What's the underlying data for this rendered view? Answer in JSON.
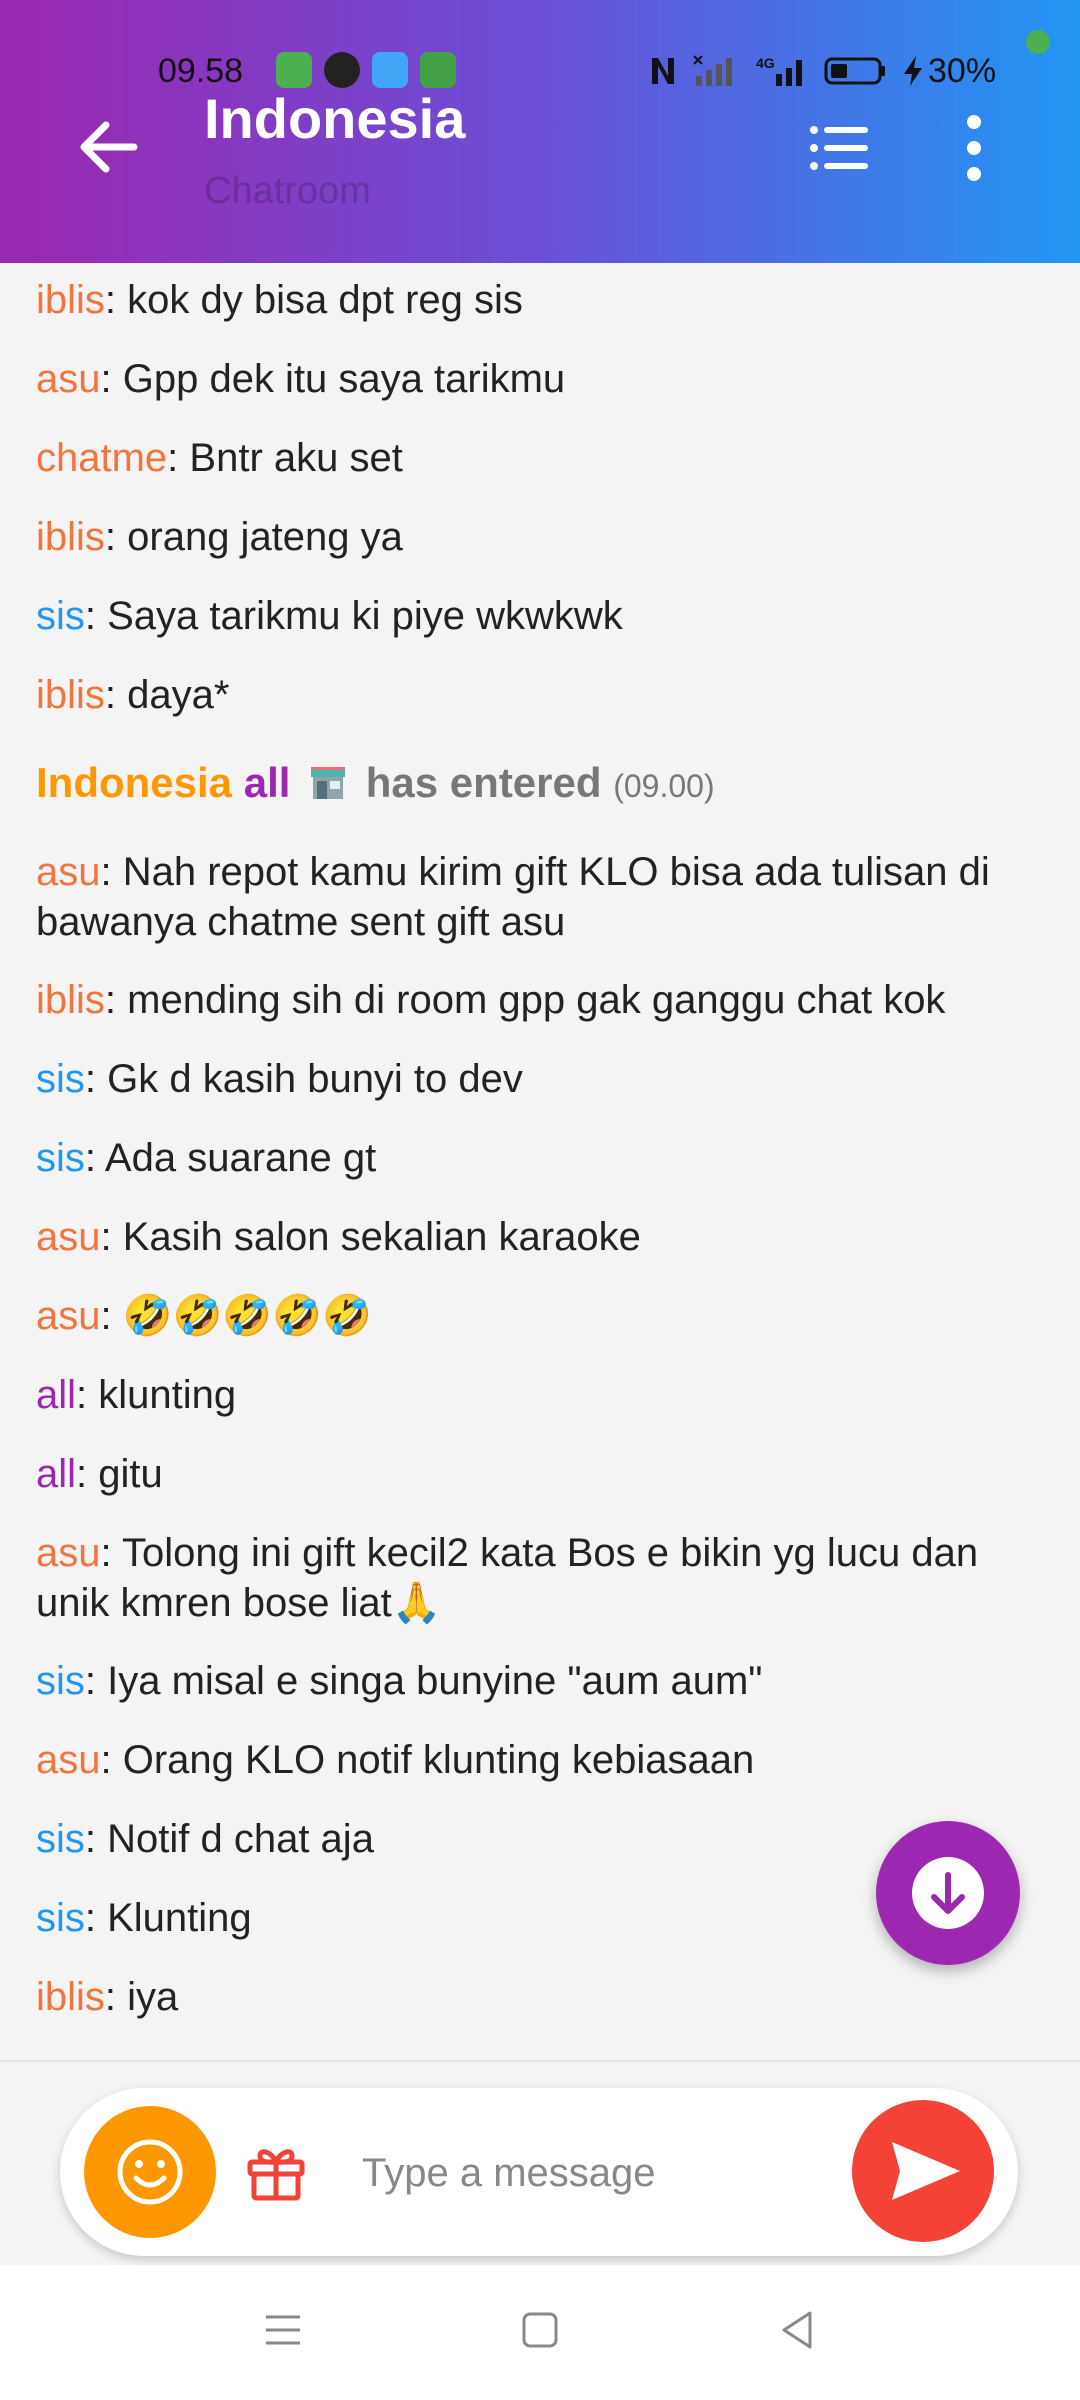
{
  "status_bar": {
    "time": "09.58",
    "battery": "30%",
    "network": "4G"
  },
  "header": {
    "title": "Indonesia",
    "subtitle": "Chatroom"
  },
  "messages": [
    {
      "user": "iblis",
      "color": "#f2753d",
      "text": ": kok dy bisa dpt reg sis"
    },
    {
      "user": "asu",
      "color": "#f2753d",
      "text": ": Gpp dek itu saya tarikmu"
    },
    {
      "user": "chatme",
      "color": "#f2753d",
      "text": ": Bntr aku set"
    },
    {
      "user": "iblis",
      "color": "#f2753d",
      "text": ": orang jateng ya"
    },
    {
      "user": "sis",
      "color": "#2196f3",
      "text": ": Saya tarikmu ki piye wkwkwk"
    },
    {
      "user": "iblis",
      "color": "#f2753d",
      "text": ": daya*"
    },
    {
      "user": "asu",
      "color": "#f2753d",
      "text": ": Nah repot kamu kirim gift KLO bisa ada tulisan di bawanya chatme sent gift asu"
    },
    {
      "user": "iblis",
      "color": "#f2753d",
      "text": ": mending sih di room gpp gak ganggu chat kok"
    },
    {
      "user": "sis",
      "color": "#2196f3",
      "text": ": Gk d kasih bunyi to dev"
    },
    {
      "user": "sis",
      "color": "#2196f3",
      "text": ": Ada suarane gt"
    },
    {
      "user": "asu",
      "color": "#f2753d",
      "text": ": Kasih salon sekalian karaoke"
    },
    {
      "user": "asu",
      "color": "#f2753d",
      "text": ": 🤣🤣🤣🤣🤣"
    },
    {
      "user": "all",
      "color": "#9c27b0",
      "text": ": klunting"
    },
    {
      "user": "all",
      "color": "#9c27b0",
      "text": ": gitu"
    },
    {
      "user": "asu",
      "color": "#f2753d",
      "text": ": Tolong ini gift kecil2 kata Bos e bikin yg lucu dan unik kmren bose liat🙏"
    },
    {
      "user": "sis",
      "color": "#2196f3",
      "text": ": Iya misal e singa bunyine  \"aum aum\""
    },
    {
      "user": "asu",
      "color": "#f2753d",
      "text": ": Orang KLO notif klunting kebiasaan"
    },
    {
      "user": "sis",
      "color": "#2196f3",
      "text": ": Notif d chat aja"
    },
    {
      "user": "sis",
      "color": "#2196f3",
      "text": ": Klunting"
    },
    {
      "user": "iblis",
      "color": "#f2753d",
      "text": ": iya"
    }
  ],
  "system_message": {
    "room": "Indonesia",
    "user": "all",
    "icon": "shop-icon",
    "text": "has entered",
    "time": "(09.00)"
  },
  "input": {
    "placeholder": "Type a message",
    "value": ""
  },
  "colors": {
    "header_start": "#9c27b0",
    "header_end": "#2196f3",
    "emoji_button": "#ff9800",
    "send_button": "#f44336",
    "fab": "#9c27b0"
  }
}
